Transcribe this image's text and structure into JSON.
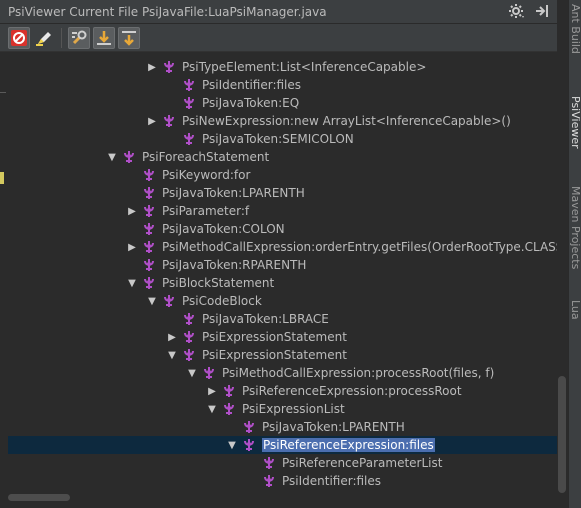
{
  "window": {
    "title": "PsiViewer Current File PsiJavaFile:LuaPsiManager.java",
    "actions": [
      "gear-icon",
      "pin-icon"
    ]
  },
  "toolbar": {
    "buttons": [
      {
        "name": "toggle-psi-button",
        "icon": "no-entry-icon"
      },
      {
        "name": "highlight-button",
        "icon": "highlighter-icon"
      },
      {
        "name": "properties-button",
        "icon": "wrench-icon"
      },
      {
        "name": "scroll-to-source-button",
        "icon": "scroll-from-icon"
      },
      {
        "name": "scroll-from-source-button",
        "icon": "scroll-to-icon"
      }
    ]
  },
  "tree": {
    "rows": [
      {
        "label": "PsiTypeElement:List<InferenceCapable>",
        "arrow": "collapsed"
      },
      {
        "label": "PsiIdentifier:files",
        "arrow": "none"
      },
      {
        "label": "PsiJavaToken:EQ",
        "arrow": "none"
      },
      {
        "label": "PsiNewExpression:new ArrayList<InferenceCapable>()",
        "arrow": "collapsed"
      },
      {
        "label": "PsiJavaToken:SEMICOLON",
        "arrow": "none"
      },
      {
        "label": "PsiForeachStatement",
        "arrow": "expanded"
      },
      {
        "label": "PsiKeyword:for",
        "arrow": "none"
      },
      {
        "label": "PsiJavaToken:LPARENTH",
        "arrow": "none"
      },
      {
        "label": "PsiParameter:f",
        "arrow": "collapsed"
      },
      {
        "label": "PsiJavaToken:COLON",
        "arrow": "none"
      },
      {
        "label": "PsiMethodCallExpression:orderEntry.getFiles(OrderRootType.CLASSES)",
        "arrow": "collapsed"
      },
      {
        "label": "PsiJavaToken:RPARENTH",
        "arrow": "none"
      },
      {
        "label": "PsiBlockStatement",
        "arrow": "expanded"
      },
      {
        "label": "PsiCodeBlock",
        "arrow": "expanded"
      },
      {
        "label": "PsiJavaToken:LBRACE",
        "arrow": "none"
      },
      {
        "label": "PsiExpressionStatement",
        "arrow": "collapsed"
      },
      {
        "label": "PsiExpressionStatement",
        "arrow": "expanded"
      },
      {
        "label": "PsiMethodCallExpression:processRoot(files, f)",
        "arrow": "expanded"
      },
      {
        "label": "PsiReferenceExpression:processRoot",
        "arrow": "collapsed"
      },
      {
        "label": "PsiExpressionList",
        "arrow": "expanded"
      },
      {
        "label": "PsiJavaToken:LPARENTH",
        "arrow": "none"
      },
      {
        "label": "PsiReferenceExpression:files",
        "arrow": "expanded",
        "selected": true
      },
      {
        "label": "PsiReferenceParameterList",
        "arrow": "none"
      },
      {
        "label": "PsiIdentifier:files",
        "arrow": "none"
      }
    ]
  },
  "right_strip": {
    "tabs": [
      {
        "label": "Ant Build",
        "active": false
      },
      {
        "label": "PsiViewer",
        "active": true
      },
      {
        "label": "Maven Projects",
        "active": false
      },
      {
        "label": "Lua",
        "active": false
      }
    ]
  },
  "colors": {
    "background": "#2b2b2b",
    "selection_row": "#0d293e",
    "selection_label": "#4b6eaf",
    "node_icon": "#b04fc8"
  }
}
